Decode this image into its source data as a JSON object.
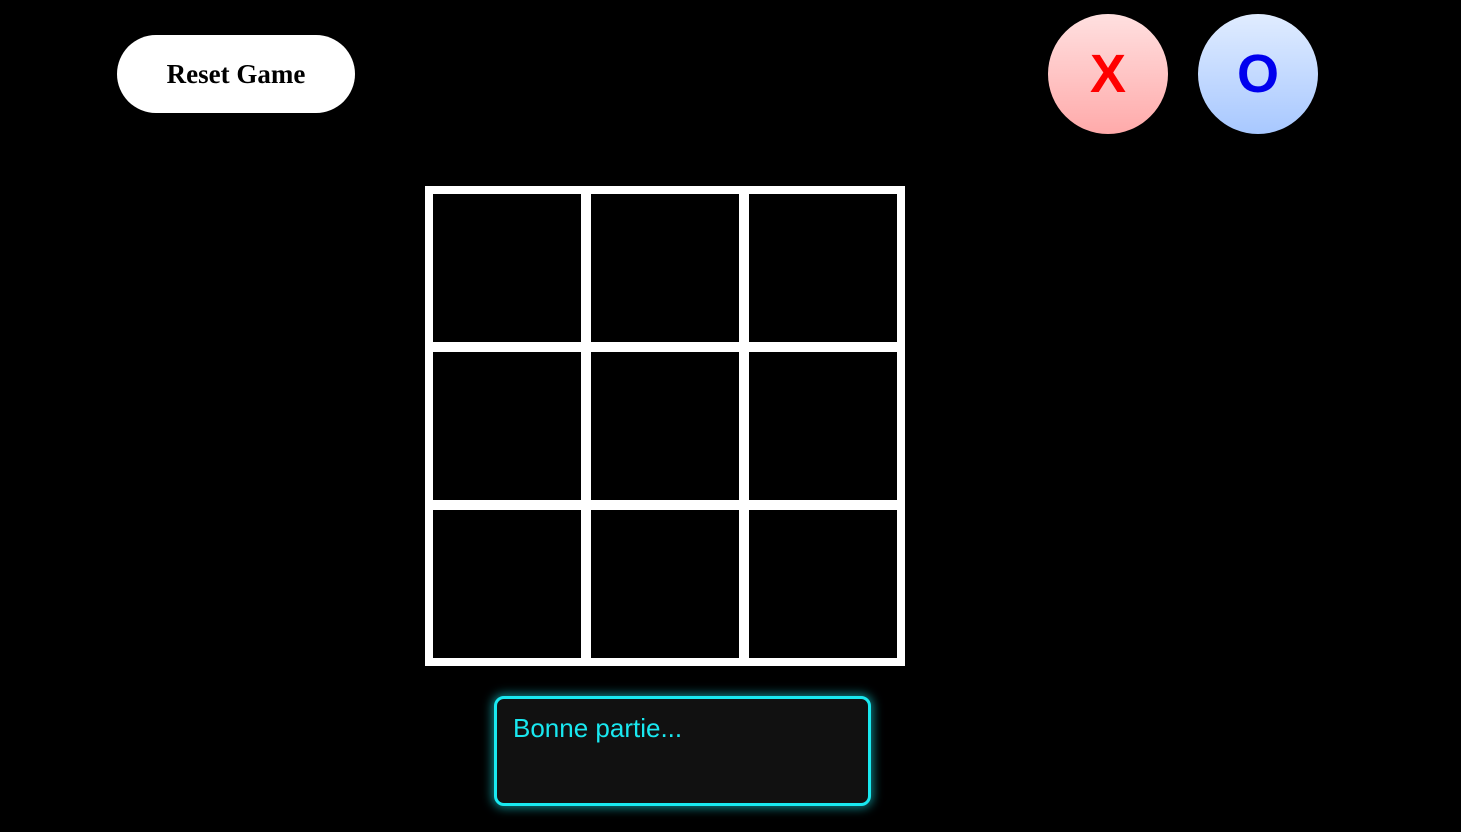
{
  "controls": {
    "reset_label": "Reset Game"
  },
  "players": [
    {
      "symbol": "X",
      "color": "#ff0000"
    },
    {
      "symbol": "O",
      "color": "#0000ee"
    }
  ],
  "board": {
    "cells": [
      "",
      "",
      "",
      "",
      "",
      "",
      "",
      "",
      ""
    ]
  },
  "status": {
    "message": "Bonne partie..."
  },
  "colors": {
    "background": "#000000",
    "grid": "#ffffff",
    "message_accent": "#19e8f0"
  }
}
